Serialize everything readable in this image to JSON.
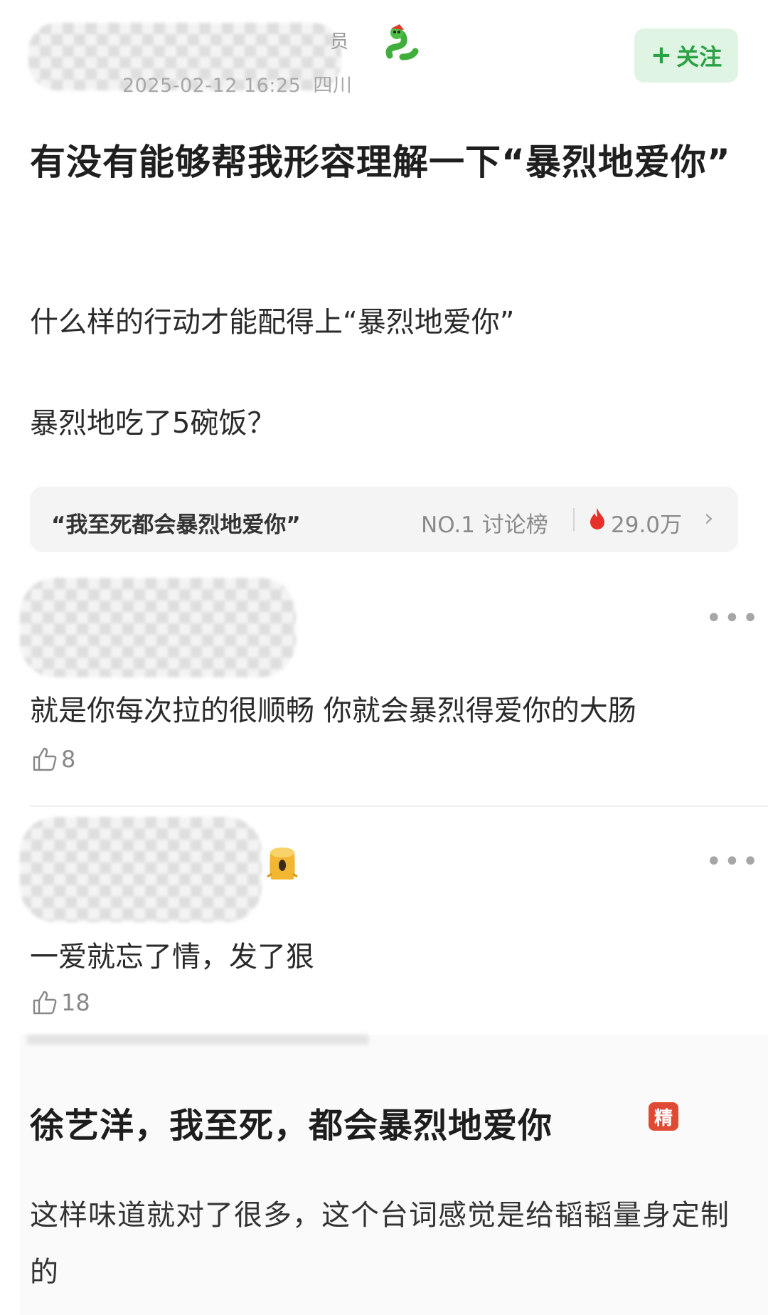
{
  "header": {
    "badge_tail": "员",
    "timestamp": "2025-02-12 16:25",
    "location": "四川",
    "follow_label": "关注",
    "follow_plus": "+"
  },
  "post": {
    "title": "有没有能够帮我形容理解一下“暴烈地爱你”",
    "paragraph1": "什么样的行动才能配得上“暴烈地爱你”",
    "paragraph2": "暴烈地吃了5碗饭？"
  },
  "topic": {
    "text": "“我至死都会暴烈地爱你”",
    "rank": "NO.1 讨论榜",
    "heat": "29.0万",
    "chevron": "›"
  },
  "comments": [
    {
      "text": "就是你每次拉的很顺畅 你就会暴烈得爱你的大肠",
      "likes": "8"
    },
    {
      "text": "一爱就忘了情，发了狠",
      "likes": "18"
    }
  ],
  "more_glyph": "•••",
  "embedded": {
    "title": "徐艺洋，我至死，都会暴烈地爱你",
    "badge": "精",
    "body": "这样味道就对了很多，这个台词感觉是给韬韬量身定制的"
  },
  "colors": {
    "follow_bg": "#dff4e3",
    "follow_text": "#2aa244",
    "heat_icon": "#e8302a",
    "badge_red": "#e04a35"
  }
}
